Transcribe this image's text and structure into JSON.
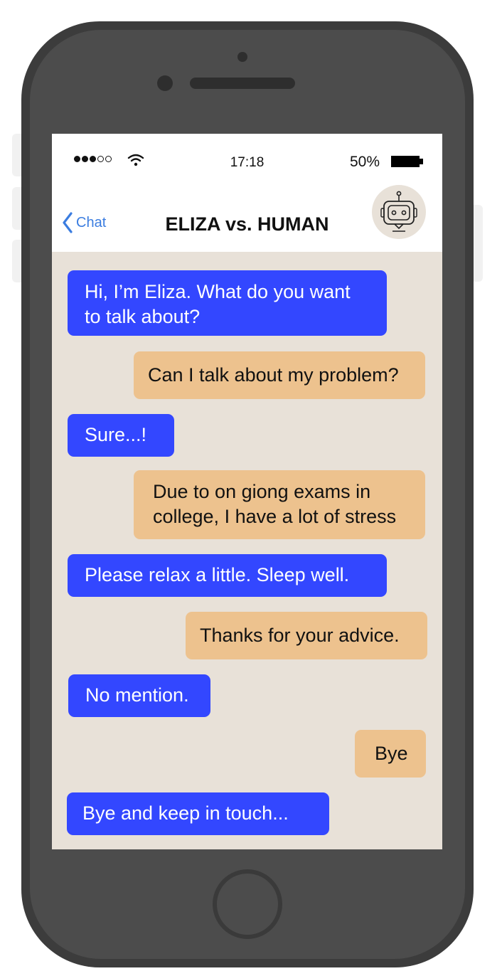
{
  "status_bar": {
    "signal": {
      "filled": 3,
      "empty": 2
    },
    "wifi_icon": "wifi-icon",
    "time": "17:18",
    "battery_percent": "50%",
    "battery_icon": "battery-icon"
  },
  "nav": {
    "back_label": "Chat",
    "title": "ELIZA vs. HUMAN",
    "avatar_icon": "robot-icon"
  },
  "colors": {
    "bot_bubble": "#3347ff",
    "human_bubble": "#edc28e",
    "chat_background": "#e8e1d8",
    "back_link": "#3b7de0"
  },
  "messages": [
    {
      "sender": "eliza",
      "text": "Hi, I’m Eliza. What do you want to talk about?"
    },
    {
      "sender": "human",
      "text": "Can I talk about my problem?"
    },
    {
      "sender": "eliza",
      "text": "Sure...!"
    },
    {
      "sender": "human",
      "text": "Due to on giong exams in college, I have a lot of stress"
    },
    {
      "sender": "eliza",
      "text": "Please relax a little. Sleep well."
    },
    {
      "sender": "human",
      "text": "Thanks for your advice."
    },
    {
      "sender": "eliza",
      "text": "No mention."
    },
    {
      "sender": "human",
      "text": "Bye"
    },
    {
      "sender": "eliza",
      "text": "Bye and keep in touch..."
    }
  ]
}
